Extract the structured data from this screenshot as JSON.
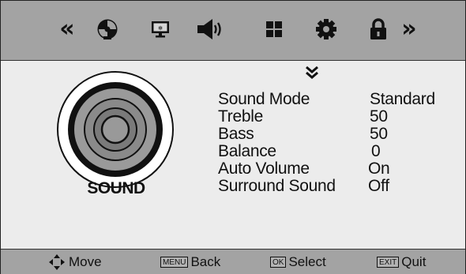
{
  "topbar": {
    "icons": [
      {
        "name": "prev-page",
        "glyph": "«"
      },
      {
        "name": "picture",
        "icon": "picture-icon"
      },
      {
        "name": "screen",
        "icon": "screen-icon"
      },
      {
        "name": "sound",
        "icon": "speaker-icon",
        "active": true
      },
      {
        "name": "channel",
        "icon": "grid-icon"
      },
      {
        "name": "setup",
        "icon": "gear-icon"
      },
      {
        "name": "lock",
        "icon": "lock-icon"
      },
      {
        "name": "next-page",
        "glyph": "»"
      }
    ]
  },
  "panel": {
    "title": "SOUND",
    "scroll_indicator_icon": "chevron-double-down-icon",
    "items": [
      {
        "label": "Sound Mode",
        "value": "Standard"
      },
      {
        "label": "Treble",
        "value": "50"
      },
      {
        "label": "Bass",
        "value": "50"
      },
      {
        "label": "Balance",
        "value": "0"
      },
      {
        "label": "Auto Volume",
        "value": "On"
      },
      {
        "label": "Surround Sound",
        "value": "Off"
      }
    ]
  },
  "footer": {
    "move": {
      "label": "Move"
    },
    "back": {
      "key": "MENU",
      "label": "Back"
    },
    "select": {
      "key": "OK",
      "label": "Select"
    },
    "quit": {
      "key": "EXIT",
      "label": "Quit"
    }
  },
  "colors": {
    "bar": "#a3a3a3",
    "panel": "#ececec",
    "text": "#111111"
  }
}
